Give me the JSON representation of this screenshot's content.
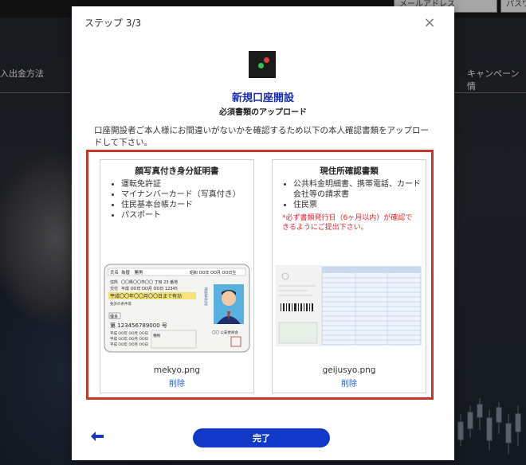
{
  "background": {
    "email_placeholder": "メールアドレス",
    "password_placeholder": "パスワ",
    "nav_left": "入出金方法",
    "nav_right": "キャンペーン情"
  },
  "modal": {
    "step": "ステップ 3/3",
    "close_icon": "×",
    "title": "新規口座開設",
    "subtitle": "必須書類のアップロード",
    "instruction": "口座開設者ご本人様にお間違いがないかを確認するため以下の本人確認書類をアップロードして下さい。",
    "id_card": {
      "title": "顔写真付き身分証明書",
      "items": [
        "運転免許証",
        "マイナンバーカード（写真付き）",
        "住民基本台帳カード",
        "パスポート"
      ],
      "file_name": "mekyo.png",
      "delete_label": "削除",
      "license": {
        "name_label": "氏名",
        "name_value": "為替　勝男",
        "birth": "昭和 OO年 OO月 OO日生",
        "address_label": "住所",
        "address_value": "〇〇県〇〇市〇〇 丁目 23 番地",
        "issue_label": "交付",
        "issue_value": "平成 OO年 OO月 OO日 12345",
        "expiry": "平成〇〇年〇〇月〇〇日まで有効",
        "condition_label": "免許の条件等",
        "vertical_label": "運転免許証",
        "excellent": "優良",
        "number": "第 123456789000 号",
        "type_rows": [
          "平成 OO年 OO月 OO日",
          "平成 OO年 OO月 OO日",
          "平成 OO年 OO月 OO日"
        ],
        "category": "種類",
        "commission": "〇〇 公安委員会"
      }
    },
    "address_doc": {
      "title": "現住所確認書類",
      "items": [
        "公共料金明細書、携帯電話、カード会社等の請求書",
        "住民票"
      ],
      "note": "*必ず書類発行日（6ヶ月以内）が確認できるようにご提出下さい。",
      "file_name": "geijusyo.png",
      "delete_label": "削除"
    },
    "done_label": "完了"
  },
  "colors": {
    "accent_blue": "#1238c8",
    "title_blue": "#1a2cb3",
    "highlight_red": "#c0392b",
    "note_red": "#e0262e",
    "link_blue": "#2a5bd7"
  }
}
